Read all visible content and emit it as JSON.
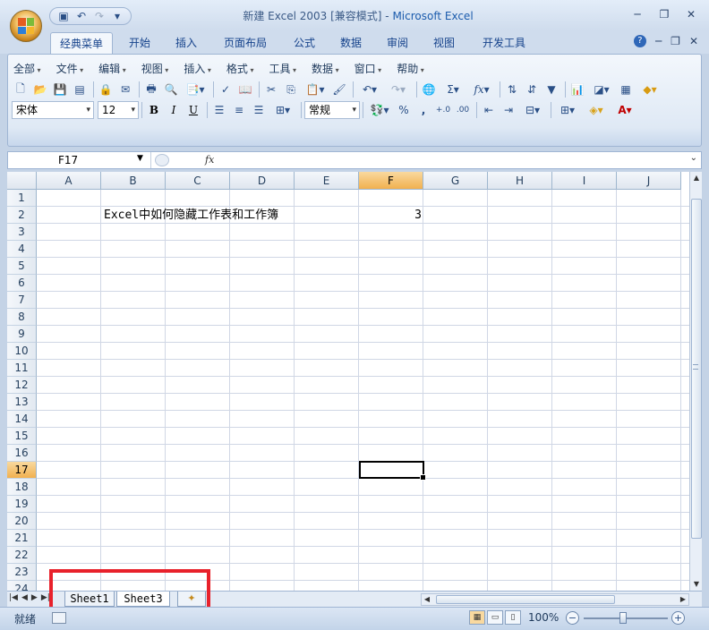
{
  "window": {
    "title_prefix": "新建 Excel 2003  [兼容模式] - ",
    "title_app": "Microsoft Excel"
  },
  "quick_access": [
    "save-icon",
    "undo-icon",
    "redo-icon",
    "customize-icon"
  ],
  "ribbon_tabs": [
    "经典菜单",
    "开始",
    "插入",
    "页面布局",
    "公式",
    "数据",
    "审阅",
    "视图",
    "开发工具"
  ],
  "menu": [
    "全部",
    "文件",
    "编辑",
    "视图",
    "插入",
    "格式",
    "工具",
    "数据",
    "窗口",
    "帮助"
  ],
  "font": {
    "name": "宋体",
    "size": "12"
  },
  "format_bold": "B",
  "format_italic": "I",
  "format_underline": "U",
  "number_format": "常规",
  "sum_symbol": "Σ",
  "fx_symbol": "fx",
  "percent_symbol": "%",
  "comma_symbol": ",",
  "formula_bar": {
    "name_box": "F17",
    "fx": "fx",
    "content": ""
  },
  "columns": [
    "A",
    "B",
    "C",
    "D",
    "E",
    "F",
    "G",
    "H",
    "I",
    "J"
  ],
  "rows": [
    "1",
    "2",
    "3",
    "4",
    "5",
    "6",
    "7",
    "8",
    "9",
    "10",
    "11",
    "12",
    "13",
    "14",
    "15",
    "16",
    "17",
    "18",
    "19",
    "20",
    "21",
    "22",
    "23",
    "24"
  ],
  "selected": {
    "column": "F",
    "row": "17"
  },
  "cells": {
    "B2": "Excel中如何隐藏工作表和工作簿",
    "F2": "3"
  },
  "sheet_tabs": [
    "Sheet1",
    "Sheet3"
  ],
  "active_sheet": "Sheet3",
  "status": {
    "ready": "就绪",
    "zoom": "100%"
  },
  "colors": {
    "highlight": "#e8212b",
    "selected_header": "#f1b04f",
    "ribbon_blue": "#15428b"
  }
}
